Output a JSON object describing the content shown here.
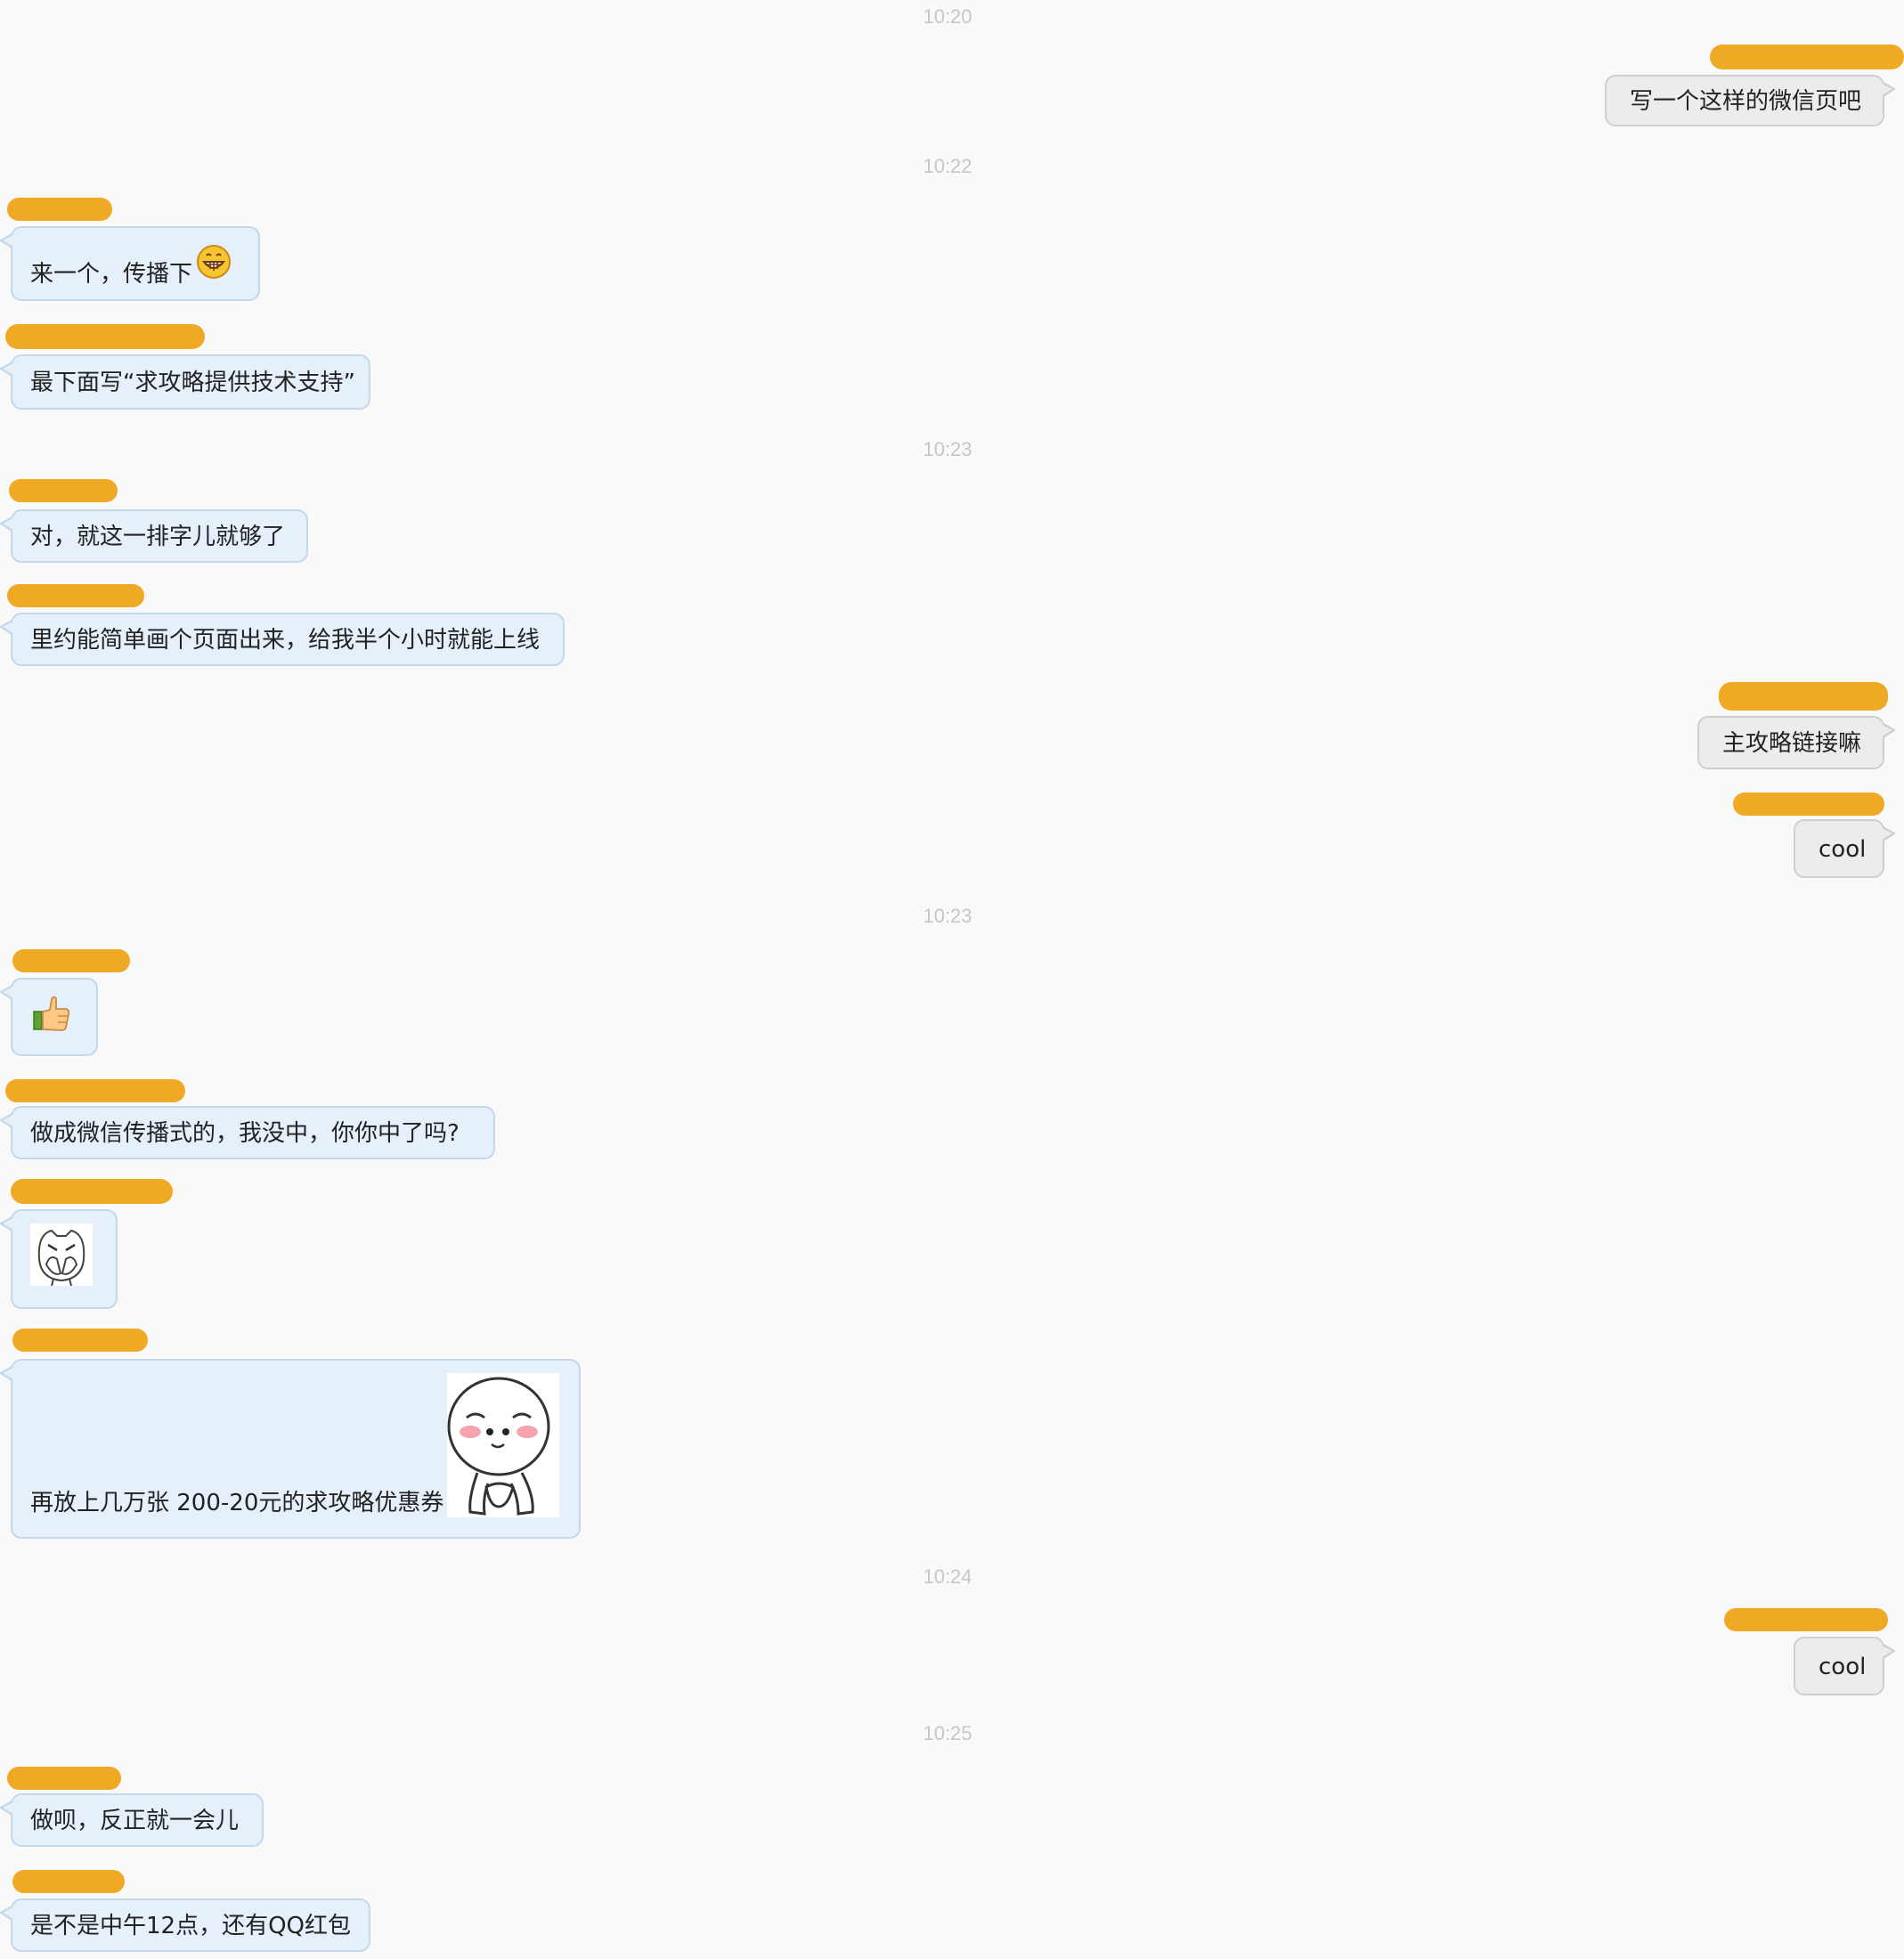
{
  "timestamps": [
    "10:20",
    "10:22",
    "10:23",
    "10:23",
    "10:24",
    "10:25"
  ],
  "messages": [
    {
      "side": "out",
      "text": "写一个这样的微信页吧"
    },
    {
      "side": "in",
      "text": "来一个，传播下",
      "emoji": "grinning-emoji"
    },
    {
      "side": "in",
      "text": "最下面写“求攻略提供技术支持”"
    },
    {
      "side": "in",
      "text": "对，就这一排字儿就够了"
    },
    {
      "side": "in",
      "text": "里约能简单画个页面出来，给我半个小时就能上线"
    },
    {
      "side": "out",
      "text": "主攻略链接嘛"
    },
    {
      "side": "out",
      "text": "cool"
    },
    {
      "side": "in",
      "text": "",
      "emoji": "thumbs-up-emoji"
    },
    {
      "side": "in",
      "text": "做成微信传播式的，我没中，你你中了吗?"
    },
    {
      "side": "in",
      "text": "",
      "emoji": "covering-face-sticker"
    },
    {
      "side": "in",
      "text": "再放上几万张  200-20元的求攻略优惠券",
      "emoji": "shy-face-sticker"
    },
    {
      "side": "out",
      "text": "cool"
    },
    {
      "side": "in",
      "text": "做呗，反正就一会儿"
    },
    {
      "side": "in",
      "text": "是不是中午12点，还有QQ红包"
    }
  ],
  "colors": {
    "background": "#f9f9f9",
    "redaction": "#f0a925",
    "incoming_bubble": "#e5f0fb",
    "incoming_border": "#c4d8ec",
    "outgoing_bubble": "#ececec",
    "outgoing_border": "#cfcfcf",
    "timestamp": "#c6c6c6"
  }
}
